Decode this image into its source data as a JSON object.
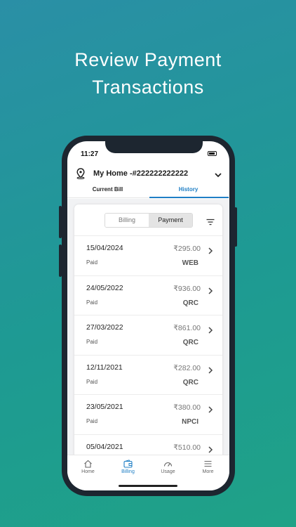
{
  "promo": {
    "line1": "Review Payment",
    "line2": "Transactions"
  },
  "status_bar": {
    "time": "11:27"
  },
  "header": {
    "title": "My Home -#222222222222"
  },
  "tabs": [
    {
      "label": "Current Bill"
    },
    {
      "label": "History"
    }
  ],
  "toggle": {
    "billing": "Billing",
    "payment": "Payment"
  },
  "transactions": [
    {
      "date": "15/04/2024",
      "amount": "₹295.00",
      "status": "Paid",
      "method": "WEB"
    },
    {
      "date": "24/05/2022",
      "amount": "₹936.00",
      "status": "Paid",
      "method": "QRC"
    },
    {
      "date": "27/03/2022",
      "amount": "₹861.00",
      "status": "Paid",
      "method": "QRC"
    },
    {
      "date": "12/11/2021",
      "amount": "₹282.00",
      "status": "Paid",
      "method": "QRC"
    },
    {
      "date": "23/05/2021",
      "amount": "₹380.00",
      "status": "Paid",
      "method": "NPCI"
    },
    {
      "date": "05/04/2021",
      "amount": "₹510.00",
      "status": "",
      "method": ""
    }
  ],
  "bottom_nav": [
    {
      "label": "Home",
      "icon": "home-icon"
    },
    {
      "label": "Billing",
      "icon": "wallet-icon"
    },
    {
      "label": "Usage",
      "icon": "gauge-icon"
    },
    {
      "label": "More",
      "icon": "menu-icon"
    }
  ],
  "colors": {
    "accent": "#1f7fc5",
    "background_top": "#2a8fa6",
    "background_bottom": "#1fa287"
  }
}
